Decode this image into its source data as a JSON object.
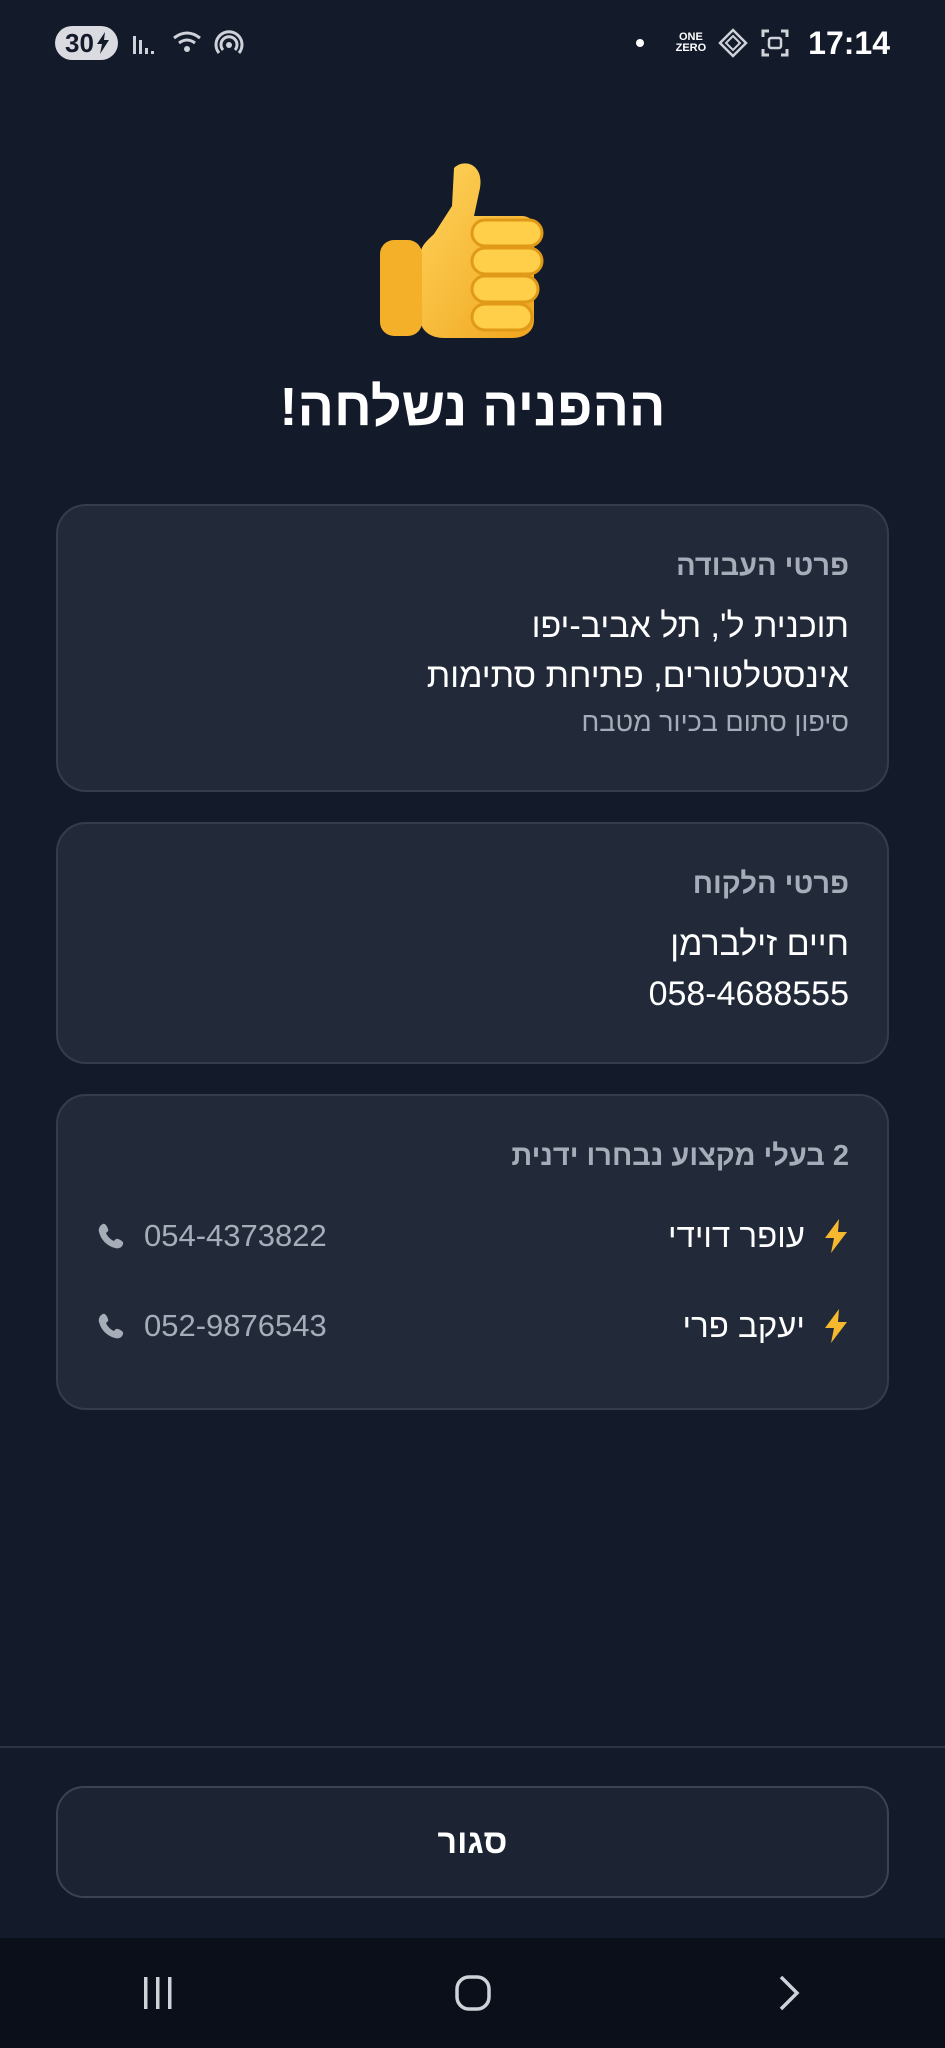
{
  "status_bar": {
    "battery": "30",
    "time": "17:14",
    "onezero_top": "ONE",
    "onezero_bottom": "ZERO"
  },
  "page": {
    "title": "ההפניה נשלחה!"
  },
  "job_card": {
    "title": "פרטי העבודה",
    "location": "תוכנית ל', תל אביב-יפו",
    "category": "אינסטלטורים, פתיחת סתימות",
    "description": "סיפון סתום בכיור מטבח"
  },
  "customer_card": {
    "title": "פרטי הלקוח",
    "name": "חיים זילברמן",
    "phone": "058-4688555"
  },
  "pros_card": {
    "title": "2 בעלי מקצוע נבחרו ידנית",
    "pros": [
      {
        "name": "עופר דוידי",
        "phone": "054-4373822"
      },
      {
        "name": "יעקב פרי",
        "phone": "052-9876543"
      }
    ]
  },
  "footer": {
    "close_label": "סגור"
  },
  "colors": {
    "background": "#131a2a",
    "card": "#222a3a",
    "accent_bolt": "#f5b82e",
    "muted_text": "#a6acb8"
  },
  "icons": [
    "thumbs-up-icon",
    "bolt-icon",
    "phone-icon",
    "recents-icon",
    "home-icon",
    "back-icon"
  ]
}
